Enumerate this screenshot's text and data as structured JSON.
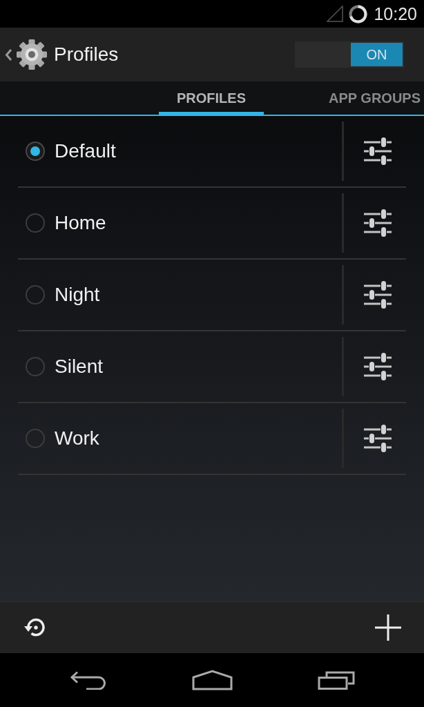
{
  "status_bar": {
    "time": "10:20"
  },
  "action_bar": {
    "title": "Profiles",
    "switch": {
      "label": "ON",
      "on": true
    }
  },
  "tabs": [
    {
      "label": "PROFILES",
      "selected": true
    },
    {
      "label": "APP GROUPS",
      "selected": false
    }
  ],
  "profiles": [
    {
      "name": "Default",
      "selected": true
    },
    {
      "name": "Home",
      "selected": false
    },
    {
      "name": "Night",
      "selected": false
    },
    {
      "name": "Silent",
      "selected": false
    },
    {
      "name": "Work",
      "selected": false
    }
  ]
}
